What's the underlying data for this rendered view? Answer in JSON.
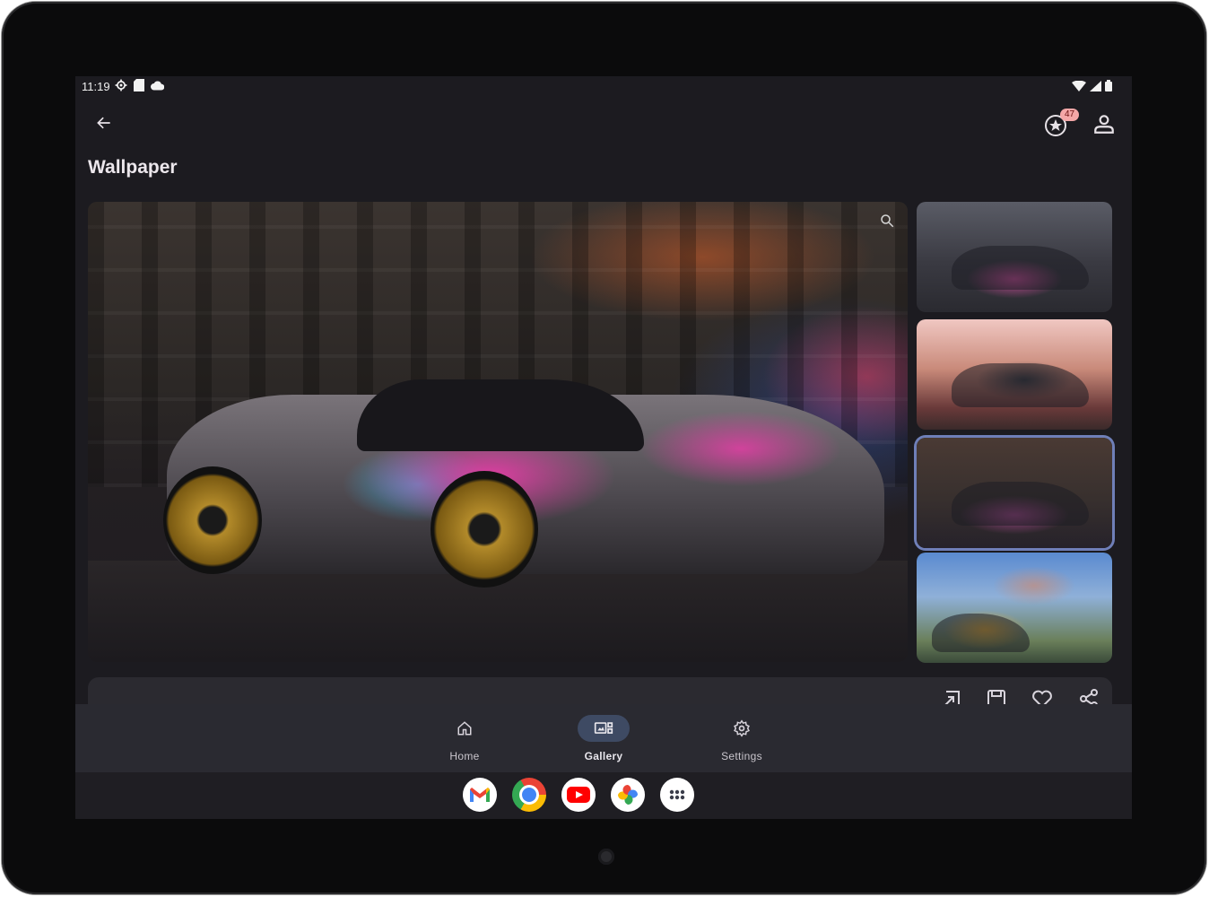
{
  "status_bar": {
    "time": "11:19",
    "left_icons": [
      "settings-icon",
      "sd-card-icon",
      "cloud-icon"
    ],
    "right_icons": [
      "wifi-icon",
      "signal-icon",
      "battery-icon"
    ]
  },
  "app_bar": {
    "title": "Wallpaper",
    "rewards_count": "47"
  },
  "gallery": {
    "selected_index": 2,
    "thumbnail_count": 4
  },
  "actions": [
    "set-wallpaper-icon",
    "save-icon",
    "favorite-icon",
    "share-icon"
  ],
  "bottom_nav": {
    "items": [
      {
        "label": "Home",
        "icon": "home-icon",
        "active": false
      },
      {
        "label": "Gallery",
        "icon": "gallery-icon",
        "active": true
      },
      {
        "label": "Settings",
        "icon": "gear-icon",
        "active": false
      }
    ]
  },
  "dock": {
    "apps": [
      "gmail-icon",
      "chrome-icon",
      "youtube-icon",
      "photos-icon",
      "app-drawer-icon"
    ]
  },
  "colors": {
    "background": "#1c1b20",
    "nav_active_pill": "#3e4a63",
    "selected_outline": "#6f7fb8",
    "badge": "#f4a7a7"
  }
}
